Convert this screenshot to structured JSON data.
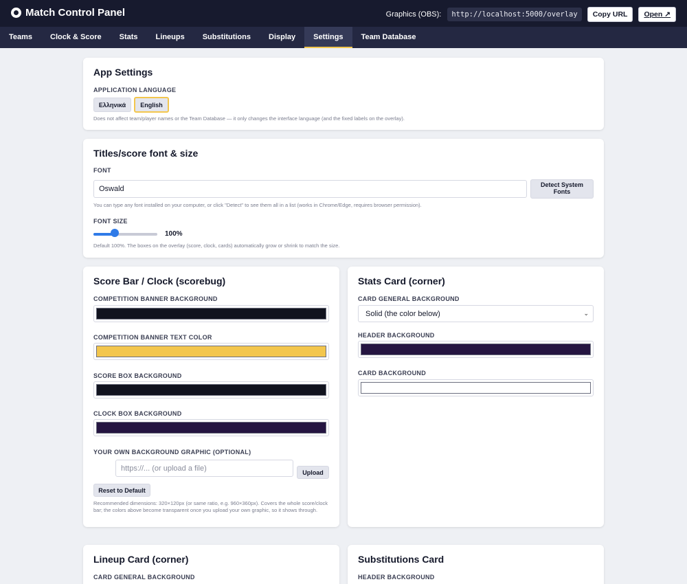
{
  "header": {
    "app_title": "Match Control Panel",
    "graphics_label": "Graphics (OBS):",
    "overlay_url": "http://localhost:5000/overlay",
    "copy_url_label": "Copy URL",
    "open_label": "Open ↗"
  },
  "nav": {
    "tabs": [
      "Teams",
      "Clock & Score",
      "Stats",
      "Lineups",
      "Substitutions",
      "Display",
      "Settings",
      "Team Database"
    ],
    "active_tab": "Settings"
  },
  "app_settings": {
    "title": "App Settings",
    "language_label": "APPLICATION LANGUAGE",
    "languages": [
      "Ελληνικά",
      "English"
    ],
    "selected_language": "English",
    "help": "Does not affect team/player names or the Team Database — it only changes the interface language (and the fixed labels on the overlay)."
  },
  "font_settings": {
    "title": "Titles/score font & size",
    "font_label": "FONT",
    "font_value": "Oswald",
    "detect_button": "Detect System Fonts",
    "font_help": "You can type any font installed on your computer, or click \"Detect\" to see them all in a list (works in Chrome/Edge, requires browser permission).",
    "size_label": "FONT SIZE",
    "size_value": "100%",
    "size_fraction": 0.33,
    "size_help": "Default 100%. The boxes on the overlay (score, clock, cards) automatically grow or shrink to match the size."
  },
  "scorebug": {
    "title": "Score Bar / Clock (scorebug)",
    "competition_bg_label": "COMPETITION BANNER BACKGROUND",
    "competition_bg_color": "#11131f",
    "competition_text_label": "COMPETITION BANNER TEXT COLOR",
    "competition_text_color": "#f3c64d",
    "score_bg_label": "SCORE BOX BACKGROUND",
    "score_bg_color": "#11131f",
    "clock_bg_label": "CLOCK BOX BACKGROUND",
    "clock_bg_color": "#251541",
    "graphic_label": "YOUR OWN BACKGROUND GRAPHIC (OPTIONAL)",
    "graphic_placeholder": "https://... (or upload a file)",
    "upload_button": "Upload",
    "reset_button": "Reset to Default",
    "help": "Recommended dimensions: 320×120px (or same ratio, e.g. 960×360px). Covers the whole score/clock bar; the colors above become transparent once you upload your own graphic, so it shows through."
  },
  "stats_card": {
    "title": "Stats Card (corner)",
    "general_bg_label": "CARD GENERAL BACKGROUND",
    "general_bg_option": "Solid (the color below)",
    "header_bg_label": "HEADER BACKGROUND",
    "header_bg_color": "#251541",
    "card_bg_label": "CARD BACKGROUND",
    "card_bg_color": "#ffffff"
  },
  "lineup_card": {
    "title": "Lineup Card (corner)",
    "general_bg_label": "CARD GENERAL BACKGROUND"
  },
  "substitutions_card": {
    "title": "Substitutions Card",
    "header_bg_label": "HEADER BACKGROUND"
  }
}
